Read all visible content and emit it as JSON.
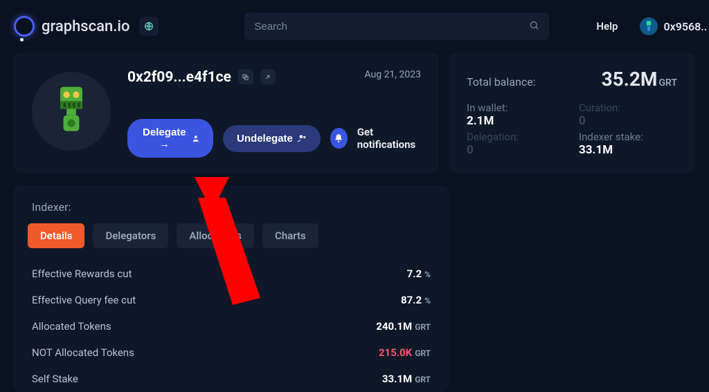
{
  "header": {
    "brand": "graphscan.io",
    "search_placeholder": "Search",
    "help": "Help",
    "wallet_short": "0x9568.."
  },
  "profile": {
    "address": "0x2f09...e4f1ce",
    "date": "Aug 21, 2023",
    "delegate_label": "Delegate →",
    "undelegate_label": "Undelegate",
    "notifications_label": "Get notifications"
  },
  "balances": {
    "total_label": "Total balance:",
    "total_value": "35.2M",
    "total_unit": "GRT",
    "cells": {
      "in_wallet_label": "In wallet:",
      "in_wallet_value": "2.1M",
      "curation_label": "Curation:",
      "curation_value": "0",
      "delegation_label": "Delegation:",
      "delegation_value": "0",
      "indexer_stake_label": "Indexer stake:",
      "indexer_stake_value": "33.1M"
    }
  },
  "indexer": {
    "section_title": "Indexer:",
    "tabs": {
      "details": "Details",
      "delegators": "Delegators",
      "allocations": "Allocations",
      "charts": "Charts"
    },
    "rows": [
      {
        "label": "Effective Rewards cut",
        "value": "7.2",
        "unit": "%",
        "red": false
      },
      {
        "label": "Effective Query fee cut",
        "value": "87.2",
        "unit": "%",
        "red": false
      },
      {
        "label": "Allocated Tokens",
        "value": "240.1M",
        "unit": "GRT",
        "red": false
      },
      {
        "label": "NOT Allocated Tokens",
        "value": "215.0K",
        "unit": "GRT",
        "red": true
      },
      {
        "label": "Self Stake",
        "value": "33.1M",
        "unit": "GRT",
        "red": false
      }
    ]
  }
}
